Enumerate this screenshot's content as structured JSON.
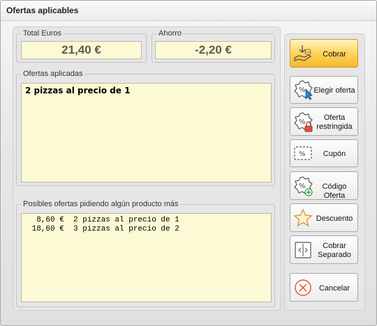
{
  "window": {
    "title": "Ofertas aplicables"
  },
  "totals": {
    "total_label": "Total Euros",
    "total_value": "21,40 €",
    "savings_label": "Ahorro",
    "savings_value": "-2,20 €"
  },
  "applied": {
    "label": "Ofertas aplicadas",
    "items": [
      "2 pizzas al precio de 1"
    ]
  },
  "possible": {
    "label": "Posibles ofertas pidiendo algún producto más",
    "items": [
      "  8,60 €  2 pizzas al precio de 1",
      " 18,60 €  3 pizzas al precio de 2"
    ]
  },
  "buttons": {
    "cobrar": "Cobrar",
    "elegir_oferta": "Elegir oferta",
    "oferta_restringida_1": "Oferta",
    "oferta_restringida_2": "restringida",
    "cupon": "Cupón",
    "codigo_oferta": "Código Oferta",
    "descuento": "Descuento",
    "cobrar_separado_1": "Cobrar",
    "cobrar_separado_2": "Separado",
    "cancelar": "Cancelar"
  },
  "icons": {
    "cobrar": "hand-coins-icon",
    "elegir_oferta": "percent-badge-cursor-icon",
    "oferta_restringida": "percent-badge-lock-icon",
    "cupon": "coupon-icon",
    "codigo_oferta": "percent-badge-plus-icon",
    "descuento": "star-icon",
    "cobrar_separado": "split-icon",
    "cancelar": "cancel-icon"
  },
  "colors": {
    "field_background": "#fcfad4",
    "primary_button": "#ffd35c",
    "cancel_red": "#e0503a",
    "accent_green": "#3a9c4a"
  }
}
